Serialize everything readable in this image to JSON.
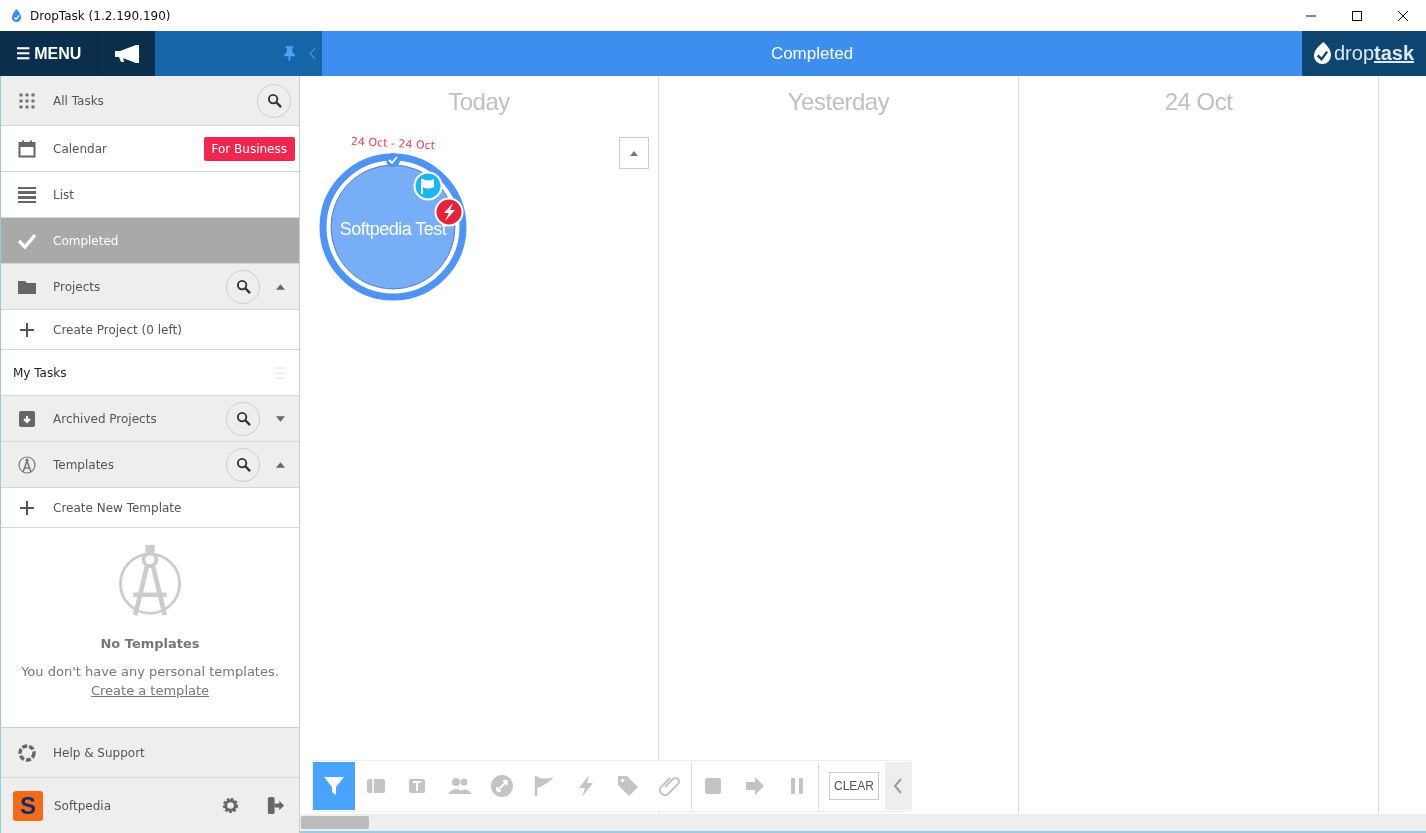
{
  "window": {
    "title": "DropTask (1.2.190.190)"
  },
  "header": {
    "menu_label": "☰ MENU",
    "title": "Completed",
    "logo": "drop**task**"
  },
  "sidebar": {
    "items": [
      {
        "kind": "nav",
        "label": "All Tasks",
        "selected": false,
        "search": true
      },
      {
        "kind": "nav",
        "label": "Calendar",
        "selected": false,
        "badge": "For Business"
      },
      {
        "kind": "nav",
        "label": "List",
        "selected": false
      },
      {
        "kind": "nav",
        "label": "Completed",
        "selected": true
      },
      {
        "kind": "section",
        "label": "Projects",
        "expanded": true
      },
      {
        "kind": "create",
        "label": "Create Project (0 left)"
      },
      {
        "kind": "project",
        "label": "My Tasks"
      },
      {
        "kind": "section",
        "label": "Archived Projects",
        "expanded": false
      },
      {
        "kind": "section",
        "label": "Templates",
        "expanded": true
      },
      {
        "kind": "create",
        "label": "Create New Template"
      }
    ],
    "empty_state": {
      "title": "No Templates",
      "text": "You don't have any personal templates.",
      "link": "Create a template"
    },
    "help": "Help & Support",
    "user": {
      "name": "Softpedia",
      "avatar_letter": "S"
    }
  },
  "columns": [
    {
      "title": "Today"
    },
    {
      "title": "Yesterday"
    },
    {
      "title": "24 Oct"
    }
  ],
  "task": {
    "title": "Softpedia Test",
    "dates": "24 Oct - 24 Oct"
  },
  "toolbar": {
    "filters": [
      {
        "selected": true
      },
      {
        "selected": false
      },
      {
        "selected": false
      },
      {
        "selected": false
      },
      {
        "selected": false
      },
      {
        "selected": false
      },
      {
        "selected": false
      },
      {
        "selected": false
      },
      {
        "selected": false
      }
    ],
    "clear_label": "CLEAR"
  }
}
